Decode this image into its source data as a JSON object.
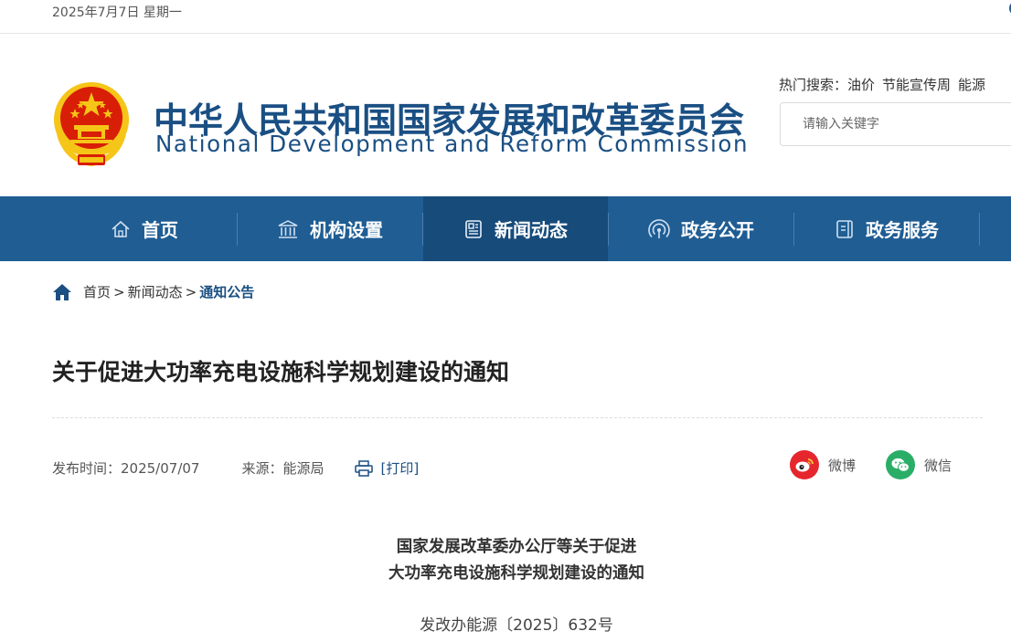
{
  "topbar": {
    "date": "2025年7月7日 星期一"
  },
  "header": {
    "title_cn": "中华人民共和国国家发展和改革委员会",
    "title_en": "National Development and Reform Commission",
    "hot_label": "热门搜索：",
    "hot_items": [
      "油价",
      "节能宣传周",
      "能源"
    ],
    "search_placeholder": "请输入关键字"
  },
  "nav": {
    "items": [
      {
        "label": "首页",
        "icon": "home-icon"
      },
      {
        "label": "机构设置",
        "icon": "institution-icon"
      },
      {
        "label": "新闻动态",
        "icon": "news-icon",
        "active": true
      },
      {
        "label": "政务公开",
        "icon": "broadcast-icon"
      },
      {
        "label": "政务服务",
        "icon": "service-icon"
      }
    ]
  },
  "breadcrumb": {
    "items": [
      "首页",
      "新闻动态",
      "通知公告"
    ],
    "separator": ">"
  },
  "article": {
    "title": "关于促进大功率充电设施科学规划建设的通知",
    "publish_time": "发布时间：2025/07/07",
    "source": "来源：能源局",
    "print_label": "[打印]",
    "share": [
      {
        "label": "微博",
        "icon": "weibo-icon"
      },
      {
        "label": "微信",
        "icon": "wechat-icon"
      }
    ],
    "doc_heading_line1": "国家发展改革委办公厅等关于促进",
    "doc_heading_line2": "大功率充电设施科学规划建设的通知",
    "doc_number": "发改办能源〔2025〕632号"
  },
  "colors": {
    "brand_blue": "#1a4f83",
    "nav_bg": "#1f5d93",
    "nav_active_bg": "#164b7a",
    "weibo_red": "#e6262d",
    "wechat_green": "#2aae67",
    "emblem_red": "#d81e06",
    "emblem_gold": "#f5c518"
  }
}
